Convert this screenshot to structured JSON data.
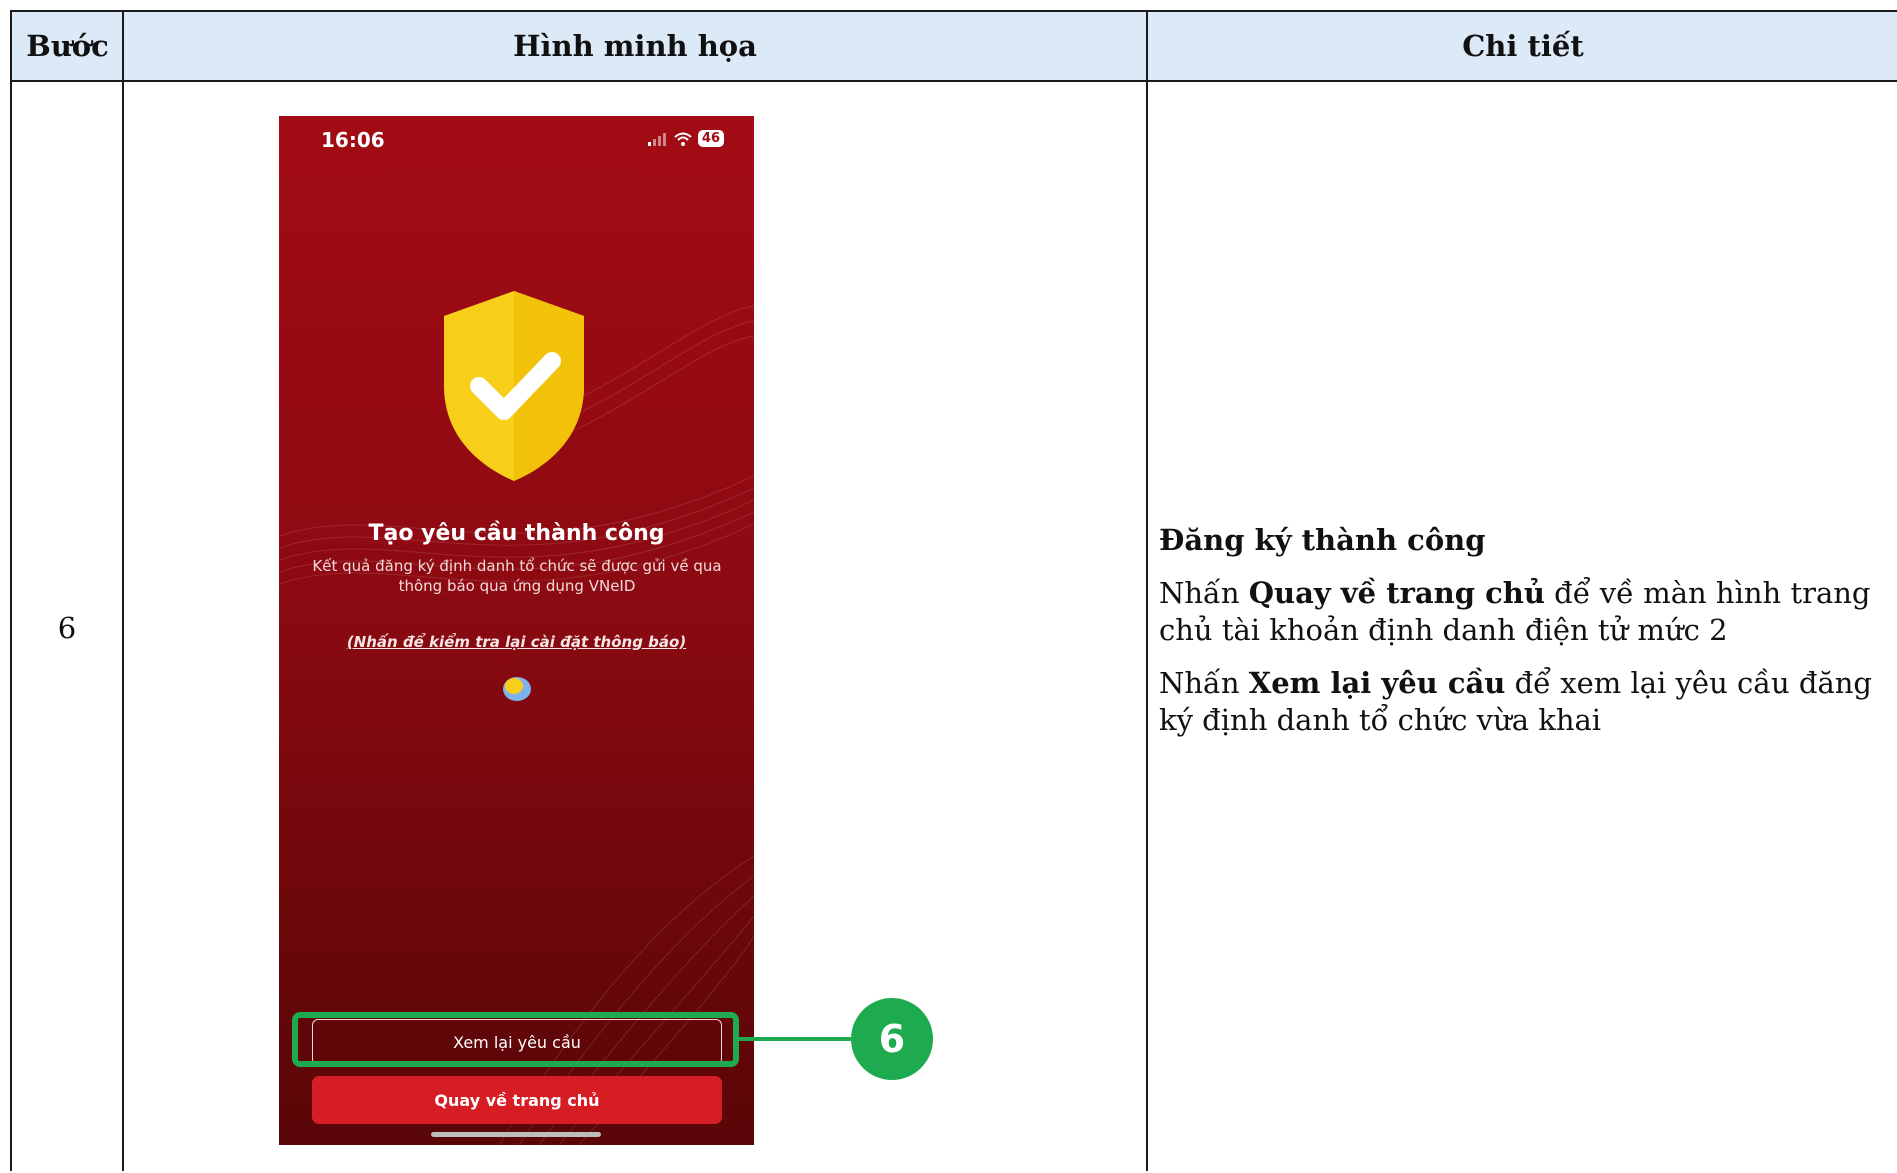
{
  "table": {
    "headers": {
      "step": "Bước",
      "illustration": "Hình minh họa",
      "details": "Chi tiết"
    },
    "row": {
      "step": "6",
      "detail_title": "Đăng ký thành công",
      "p1": {
        "prefix": "Nhấn ",
        "bold": "Quay về trang chủ",
        "suffix": " để về màn hình trang chủ tài khoản định danh điện tử mức 2"
      },
      "p2": {
        "prefix": "Nhấn ",
        "bold": "Xem lại yêu cầu",
        "suffix": " để xem lại yêu cầu đăng ký định danh tổ chức vừa khai"
      }
    }
  },
  "phone": {
    "time": "16:06",
    "battery": "46",
    "title": "Tạo yêu cầu thành công",
    "description": "Kết quả đăng ký định danh tổ chức sẽ được gửi về qua thông báo qua ứng dụng VNeID",
    "link": "(Nhấn để kiểm tra lại cài đặt thông báo)",
    "button_review": "Xem lại yêu cầu",
    "button_home": "Quay về trang chủ"
  },
  "callout": {
    "number": "6"
  },
  "colors": {
    "header_bg": "#dce9f6",
    "phone_red": "#a20b14",
    "button_red": "#d71d24",
    "highlight_green": "#1eab4f"
  }
}
